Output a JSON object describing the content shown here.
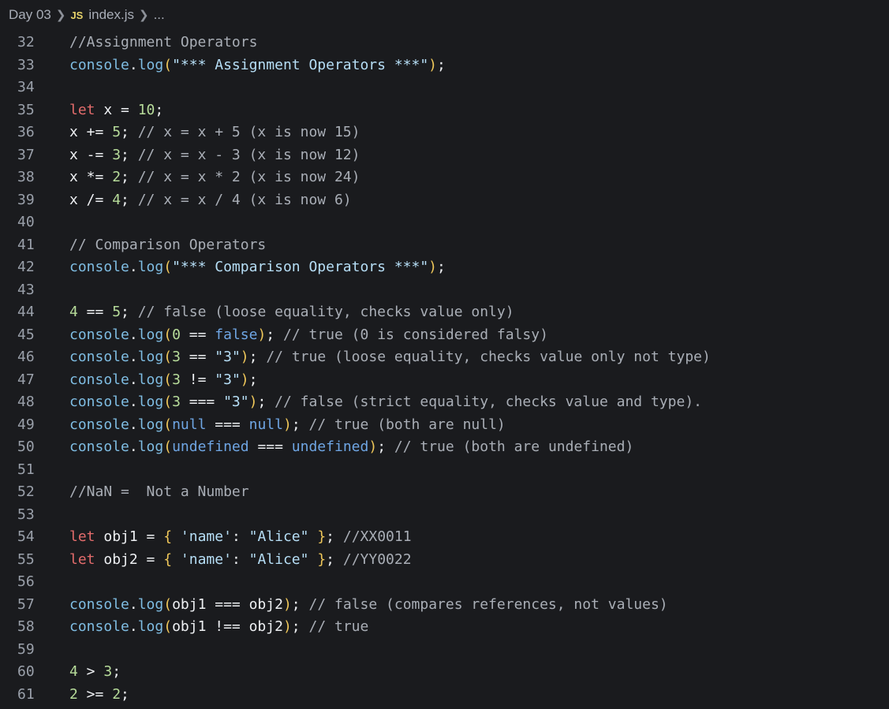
{
  "breadcrumb": {
    "folder": "Day 03",
    "file_badge": "JS",
    "file": "index.js",
    "tail": "..."
  },
  "editor": {
    "language": "javascript",
    "lines": [
      {
        "n": "32",
        "tokens": [
          {
            "t": "//Assignment Operators",
            "c": "cm"
          }
        ]
      },
      {
        "n": "33",
        "tokens": [
          {
            "t": "console",
            "c": "fn"
          },
          {
            "t": ".",
            "c": "pl"
          },
          {
            "t": "log",
            "c": "fn"
          },
          {
            "t": "(",
            "c": "br1"
          },
          {
            "t": "\"*** Assignment Operators ***\"",
            "c": "str"
          },
          {
            "t": ")",
            "c": "br1"
          },
          {
            "t": ";",
            "c": "pl"
          }
        ]
      },
      {
        "n": "34",
        "tokens": []
      },
      {
        "n": "35",
        "tokens": [
          {
            "t": "let",
            "c": "kw"
          },
          {
            "t": " x = ",
            "c": "id"
          },
          {
            "t": "10",
            "c": "num"
          },
          {
            "t": ";",
            "c": "pl"
          }
        ]
      },
      {
        "n": "36",
        "tokens": [
          {
            "t": "x += ",
            "c": "id"
          },
          {
            "t": "5",
            "c": "num"
          },
          {
            "t": "; ",
            "c": "pl"
          },
          {
            "t": "// x = x + 5 (x is now 15)",
            "c": "cm"
          }
        ]
      },
      {
        "n": "37",
        "tokens": [
          {
            "t": "x -= ",
            "c": "id"
          },
          {
            "t": "3",
            "c": "num"
          },
          {
            "t": "; ",
            "c": "pl"
          },
          {
            "t": "// x = x - 3 (x is now 12)",
            "c": "cm"
          }
        ]
      },
      {
        "n": "38",
        "tokens": [
          {
            "t": "x *= ",
            "c": "id"
          },
          {
            "t": "2",
            "c": "num"
          },
          {
            "t": "; ",
            "c": "pl"
          },
          {
            "t": "// x = x * 2 (x is now 24)",
            "c": "cm"
          }
        ]
      },
      {
        "n": "39",
        "tokens": [
          {
            "t": "x /= ",
            "c": "id"
          },
          {
            "t": "4",
            "c": "num"
          },
          {
            "t": "; ",
            "c": "pl"
          },
          {
            "t": "// x = x / 4 (x is now 6)",
            "c": "cm"
          }
        ]
      },
      {
        "n": "40",
        "tokens": []
      },
      {
        "n": "41",
        "tokens": [
          {
            "t": "// Comparison Operators",
            "c": "cm"
          }
        ]
      },
      {
        "n": "42",
        "tokens": [
          {
            "t": "console",
            "c": "fn"
          },
          {
            "t": ".",
            "c": "pl"
          },
          {
            "t": "log",
            "c": "fn"
          },
          {
            "t": "(",
            "c": "br1"
          },
          {
            "t": "\"*** Comparison Operators ***\"",
            "c": "str"
          },
          {
            "t": ")",
            "c": "br1"
          },
          {
            "t": ";",
            "c": "pl"
          }
        ]
      },
      {
        "n": "43",
        "tokens": []
      },
      {
        "n": "44",
        "tokens": [
          {
            "t": "4",
            "c": "num"
          },
          {
            "t": " == ",
            "c": "op"
          },
          {
            "t": "5",
            "c": "num"
          },
          {
            "t": "; ",
            "c": "pl"
          },
          {
            "t": "// false (loose equality, checks value only)",
            "c": "cm"
          }
        ]
      },
      {
        "n": "45",
        "tokens": [
          {
            "t": "console",
            "c": "fn"
          },
          {
            "t": ".",
            "c": "pl"
          },
          {
            "t": "log",
            "c": "fn"
          },
          {
            "t": "(",
            "c": "br1"
          },
          {
            "t": "0",
            "c": "num"
          },
          {
            "t": " == ",
            "c": "op"
          },
          {
            "t": "false",
            "c": "lit"
          },
          {
            "t": ")",
            "c": "br1"
          },
          {
            "t": "; ",
            "c": "pl"
          },
          {
            "t": "// true (0 is considered falsy)",
            "c": "cm"
          }
        ]
      },
      {
        "n": "46",
        "tokens": [
          {
            "t": "console",
            "c": "fn"
          },
          {
            "t": ".",
            "c": "pl"
          },
          {
            "t": "log",
            "c": "fn"
          },
          {
            "t": "(",
            "c": "br1"
          },
          {
            "t": "3",
            "c": "num"
          },
          {
            "t": " == ",
            "c": "op"
          },
          {
            "t": "\"3\"",
            "c": "str"
          },
          {
            "t": ")",
            "c": "br1"
          },
          {
            "t": "; ",
            "c": "pl"
          },
          {
            "t": "// true (loose equality, checks value only not type)",
            "c": "cm"
          }
        ]
      },
      {
        "n": "47",
        "tokens": [
          {
            "t": "console",
            "c": "fn"
          },
          {
            "t": ".",
            "c": "pl"
          },
          {
            "t": "log",
            "c": "fn"
          },
          {
            "t": "(",
            "c": "br1"
          },
          {
            "t": "3",
            "c": "num"
          },
          {
            "t": " != ",
            "c": "op"
          },
          {
            "t": "\"3\"",
            "c": "str"
          },
          {
            "t": ")",
            "c": "br1"
          },
          {
            "t": ";",
            "c": "pl"
          }
        ]
      },
      {
        "n": "48",
        "tokens": [
          {
            "t": "console",
            "c": "fn"
          },
          {
            "t": ".",
            "c": "pl"
          },
          {
            "t": "log",
            "c": "fn"
          },
          {
            "t": "(",
            "c": "br1"
          },
          {
            "t": "3",
            "c": "num"
          },
          {
            "t": " === ",
            "c": "op"
          },
          {
            "t": "\"3\"",
            "c": "str"
          },
          {
            "t": ")",
            "c": "br1"
          },
          {
            "t": "; ",
            "c": "pl"
          },
          {
            "t": "// false (strict equality, checks value and type).",
            "c": "cm"
          }
        ]
      },
      {
        "n": "49",
        "tokens": [
          {
            "t": "console",
            "c": "fn"
          },
          {
            "t": ".",
            "c": "pl"
          },
          {
            "t": "log",
            "c": "fn"
          },
          {
            "t": "(",
            "c": "br1"
          },
          {
            "t": "null",
            "c": "lit"
          },
          {
            "t": " === ",
            "c": "op"
          },
          {
            "t": "null",
            "c": "lit"
          },
          {
            "t": ")",
            "c": "br1"
          },
          {
            "t": "; ",
            "c": "pl"
          },
          {
            "t": "// true (both are null)",
            "c": "cm"
          }
        ]
      },
      {
        "n": "50",
        "tokens": [
          {
            "t": "console",
            "c": "fn"
          },
          {
            "t": ".",
            "c": "pl"
          },
          {
            "t": "log",
            "c": "fn"
          },
          {
            "t": "(",
            "c": "br1"
          },
          {
            "t": "undefined",
            "c": "lit"
          },
          {
            "t": " === ",
            "c": "op"
          },
          {
            "t": "undefined",
            "c": "lit"
          },
          {
            "t": ")",
            "c": "br1"
          },
          {
            "t": "; ",
            "c": "pl"
          },
          {
            "t": "// true (both are undefined)",
            "c": "cm"
          }
        ]
      },
      {
        "n": "51",
        "tokens": []
      },
      {
        "n": "52",
        "tokens": [
          {
            "t": "//NaN =  Not a Number",
            "c": "cm"
          }
        ]
      },
      {
        "n": "53",
        "tokens": []
      },
      {
        "n": "54",
        "tokens": [
          {
            "t": "let",
            "c": "kw"
          },
          {
            "t": " obj1 = ",
            "c": "id"
          },
          {
            "t": "{",
            "c": "br1"
          },
          {
            "t": " ",
            "c": "pl"
          },
          {
            "t": "'name'",
            "c": "str"
          },
          {
            "t": ": ",
            "c": "pl"
          },
          {
            "t": "\"Alice\"",
            "c": "str"
          },
          {
            "t": " ",
            "c": "pl"
          },
          {
            "t": "}",
            "c": "br1"
          },
          {
            "t": "; ",
            "c": "pl"
          },
          {
            "t": "//XX0011",
            "c": "cm"
          }
        ]
      },
      {
        "n": "55",
        "tokens": [
          {
            "t": "let",
            "c": "kw"
          },
          {
            "t": " obj2 = ",
            "c": "id"
          },
          {
            "t": "{",
            "c": "br1"
          },
          {
            "t": " ",
            "c": "pl"
          },
          {
            "t": "'name'",
            "c": "str"
          },
          {
            "t": ": ",
            "c": "pl"
          },
          {
            "t": "\"Alice\"",
            "c": "str"
          },
          {
            "t": " ",
            "c": "pl"
          },
          {
            "t": "}",
            "c": "br1"
          },
          {
            "t": "; ",
            "c": "pl"
          },
          {
            "t": "//YY0022",
            "c": "cm"
          }
        ]
      },
      {
        "n": "56",
        "tokens": []
      },
      {
        "n": "57",
        "tokens": [
          {
            "t": "console",
            "c": "fn"
          },
          {
            "t": ".",
            "c": "pl"
          },
          {
            "t": "log",
            "c": "fn"
          },
          {
            "t": "(",
            "c": "br1"
          },
          {
            "t": "obj1 === obj2",
            "c": "id"
          },
          {
            "t": ")",
            "c": "br1"
          },
          {
            "t": "; ",
            "c": "pl"
          },
          {
            "t": "// false (compares references, not values)",
            "c": "cm"
          }
        ]
      },
      {
        "n": "58",
        "tokens": [
          {
            "t": "console",
            "c": "fn"
          },
          {
            "t": ".",
            "c": "pl"
          },
          {
            "t": "log",
            "c": "fn"
          },
          {
            "t": "(",
            "c": "br1"
          },
          {
            "t": "obj1 !== obj2",
            "c": "id"
          },
          {
            "t": ")",
            "c": "br1"
          },
          {
            "t": "; ",
            "c": "pl"
          },
          {
            "t": "// true",
            "c": "cm"
          }
        ]
      },
      {
        "n": "59",
        "tokens": []
      },
      {
        "n": "60",
        "tokens": [
          {
            "t": "4",
            "c": "num"
          },
          {
            "t": " > ",
            "c": "op"
          },
          {
            "t": "3",
            "c": "num"
          },
          {
            "t": ";",
            "c": "pl"
          }
        ]
      },
      {
        "n": "61",
        "tokens": [
          {
            "t": "2",
            "c": "num"
          },
          {
            "t": " >= ",
            "c": "op"
          },
          {
            "t": "2",
            "c": "num"
          },
          {
            "t": ";",
            "c": "pl"
          }
        ]
      }
    ]
  }
}
